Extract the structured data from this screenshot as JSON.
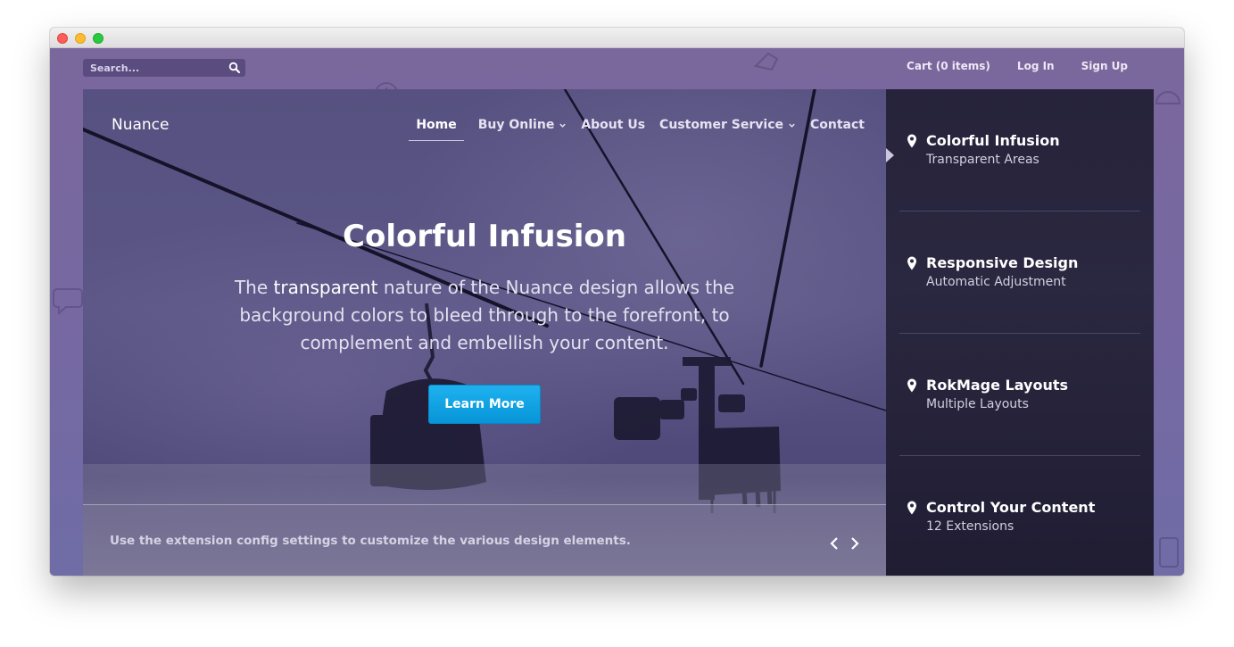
{
  "topbar": {
    "search_placeholder": "Search...",
    "links": {
      "cart": "Cart (0 items)",
      "login": "Log In",
      "signup": "Sign Up"
    }
  },
  "brand": "Nuance",
  "nav": {
    "home": "Home",
    "buy_online": "Buy Online",
    "about": "About Us",
    "customer_service": "Customer Service",
    "contact": "Contact"
  },
  "hero": {
    "title": "Colorful Infusion",
    "text_before": "The ",
    "text_em": "transparent",
    "text_after": " nature of the Nuance design allows the background colors to bleed through to the forefront, to complement and embellish your content.",
    "button": "Learn More"
  },
  "caption": "Use the extension config settings to customize the various design elements.",
  "sidebar": {
    "items": [
      {
        "title": "Colorful Infusion",
        "subtitle": "Transparent Areas"
      },
      {
        "title": "Responsive Design",
        "subtitle": "Automatic Adjustment"
      },
      {
        "title": "RokMage Layouts",
        "subtitle": "Multiple Layouts"
      },
      {
        "title": "Control Your Content",
        "subtitle": "12 Extensions"
      }
    ]
  },
  "colors": {
    "background": "#7a689e",
    "accent_button": "#0a9ee0",
    "sidebar": "#26233a"
  },
  "icons": [
    "search-icon",
    "chevron-down-icon",
    "map-pin-icon",
    "chevron-left-icon",
    "chevron-right-icon"
  ]
}
